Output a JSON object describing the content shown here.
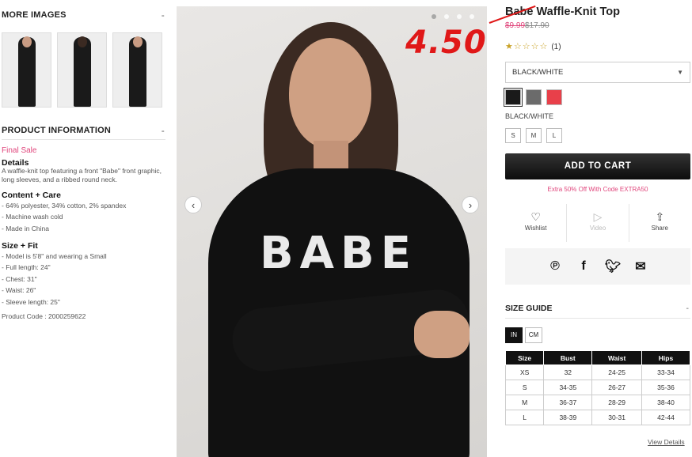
{
  "more_images": {
    "heading": "MORE IMAGES",
    "toggle": "-"
  },
  "product_info": {
    "heading": "PRODUCT INFORMATION",
    "toggle": "-",
    "final_sale": "Final Sale",
    "details_heading": "Details",
    "details_text": "A waffle-knit top featuring a front \"Babe\" front graphic, long sleeves, and a ribbed round neck.",
    "content_heading": "Content + Care",
    "content_items": [
      "- 64% polyester, 34% cotton, 2% spandex",
      "- Machine wash cold",
      "- Made in China"
    ],
    "size_heading": "Size + Fit",
    "size_items": [
      "- Model is 5'8\" and wearing a Small",
      "- Full length: 24\"",
      "- Chest: 31\"",
      "- Waist: 26\"",
      "- Sleeve length: 25\""
    ],
    "product_code": "Product Code : 2000259622"
  },
  "main_image": {
    "graphic_text": "BABE",
    "prev_icon": "‹",
    "next_icon": "›"
  },
  "product": {
    "title": "Babe Waffle-Knit Top",
    "sale_price": "$9.99",
    "original_price": "$17.90",
    "overlay_price": "4.50",
    "rating_stars": "★☆☆☆☆",
    "review_count": "(1)",
    "color_selected": "BLACK/WHITE",
    "color_label": "BLACK/WHITE",
    "swatch_colors": [
      "#1a1a1a",
      "#6b6b6b",
      "#e8404a"
    ],
    "sizes": [
      "S",
      "M",
      "L"
    ],
    "add_to_cart": "ADD TO CART",
    "promo": "Extra 50% Off With Code EXTRA50"
  },
  "actions": {
    "wishlist": "Wishlist",
    "video": "Video",
    "share": "Share"
  },
  "size_guide": {
    "heading": "SIZE GUIDE",
    "toggle": "-",
    "unit_in": "IN",
    "unit_cm": "CM",
    "columns": [
      "Size",
      "Bust",
      "Waist",
      "Hips"
    ],
    "rows": [
      [
        "XS",
        "32",
        "24-25",
        "33-34"
      ],
      [
        "S",
        "34-35",
        "26-27",
        "35-36"
      ],
      [
        "M",
        "36-37",
        "28-29",
        "38-40"
      ],
      [
        "L",
        "38-39",
        "30-31",
        "42-44"
      ]
    ],
    "view_details": "View Details"
  }
}
